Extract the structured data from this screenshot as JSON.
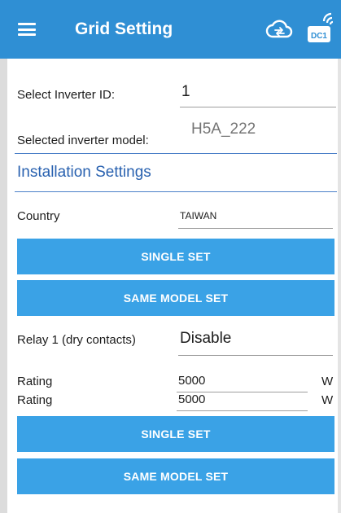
{
  "header": {
    "title": "Grid Setting",
    "menu_icon": "hamburger-menu-icon",
    "cloud_icon": "cloud-sync-icon",
    "device_icon": "dc1-wifi-device-icon",
    "device_badge": "DC1",
    "background_color": "#2f8fd4"
  },
  "inverter": {
    "id_label": "Select Inverter ID:",
    "id_value": "1",
    "model_label": "Selected inverter model:",
    "model_value": "H5A_222"
  },
  "installation": {
    "section_title": "Installation Settings",
    "country_label": "Country",
    "country_value": "TAIWAN",
    "single_set_label": "SINGLE SET",
    "same_model_set_label": "SAME MODEL SET"
  },
  "relay": {
    "label": "Relay 1 (dry contacts)",
    "value": "Disable",
    "ratings": [
      {
        "label": "Rating",
        "value": "5000",
        "unit": "W"
      },
      {
        "label": "Rating",
        "value": "5000",
        "unit": "W"
      }
    ],
    "single_set_label": "SINGLE SET",
    "same_model_set_label": "SAME MODEL SET"
  },
  "colors": {
    "accent": "#3aa2e6",
    "section_title": "#2a62b0"
  }
}
